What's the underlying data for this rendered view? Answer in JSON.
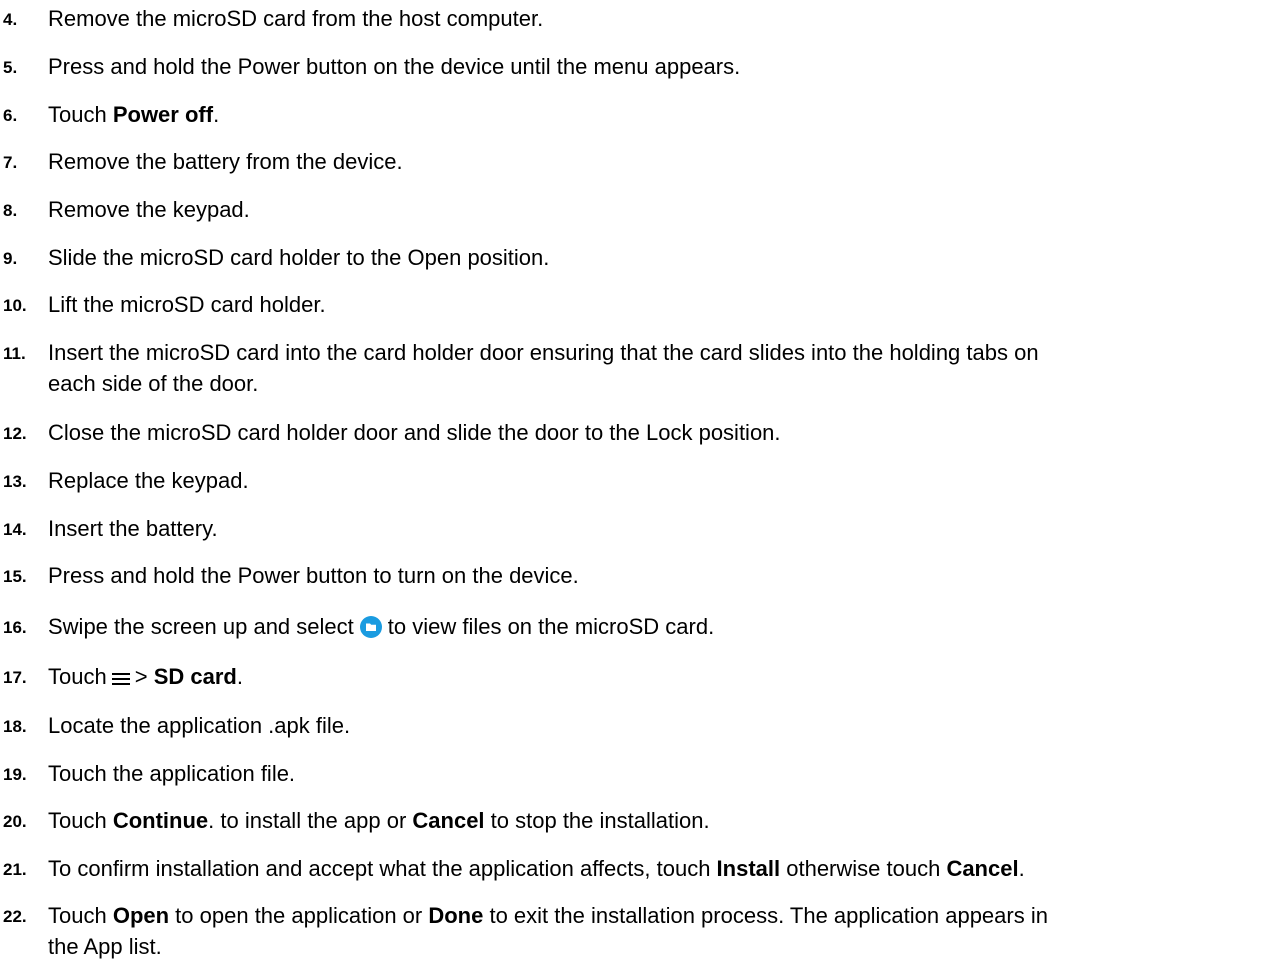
{
  "steps": [
    {
      "number": "4.",
      "text": "Remove the microSD card from the host computer."
    },
    {
      "number": "5.",
      "text": "Press and hold the Power button on the device until the menu appears."
    },
    {
      "number": "6.",
      "pre": "Touch ",
      "bold": "Power off",
      "post": "."
    },
    {
      "number": "7.",
      "text": "Remove the battery from the device."
    },
    {
      "number": "8.",
      "text": "Remove the keypad."
    },
    {
      "number": "9.",
      "text": "Slide the microSD card holder to the Open position."
    },
    {
      "number": "10.",
      "text": "Lift the microSD card holder."
    },
    {
      "number": "11.",
      "line1": "Insert the microSD card into the card holder door ensuring that the card slides into the holding tabs on",
      "line2": "each side of the door."
    },
    {
      "number": "12.",
      "text": "Close the microSD card holder door and slide the door to the Lock position."
    },
    {
      "number": "13.",
      "text": "Replace the keypad."
    },
    {
      "number": "14.",
      "text": "Insert the battery."
    },
    {
      "number": "15.",
      "text": "Press and hold the Power button to turn on the device."
    },
    {
      "number": "16.",
      "pre": "Swipe the screen up and select",
      "icon": "files-folder-icon",
      "post": "to view files on the microSD card."
    },
    {
      "number": "17.",
      "pre": "Touch",
      "icon": "menu-icon",
      "sep": ">",
      "bold": "SD card",
      "post": "."
    },
    {
      "number": "18.",
      "text": "Locate the application .apk file."
    },
    {
      "number": "19.",
      "text": "Touch the application file."
    },
    {
      "number": "20.",
      "pre": "Touch ",
      "bold": "Continue",
      "mid": ". to install the app or ",
      "bold2": "Cancel",
      "post": " to stop the installation."
    },
    {
      "number": "21.",
      "pre": "To confirm installation and accept what the application affects, touch ",
      "bold": "Install",
      "mid": " otherwise touch ",
      "bold2": "Cancel",
      "post": "."
    },
    {
      "number": "22.",
      "pre": "Touch ",
      "bold": "Open",
      "mid": " to open the application or ",
      "bold2": "Done",
      "post": " to exit the installation process. The application appears in",
      "line2": "the App list."
    }
  ],
  "colors": {
    "text": "#000000",
    "files_icon": "#1a9be0"
  }
}
